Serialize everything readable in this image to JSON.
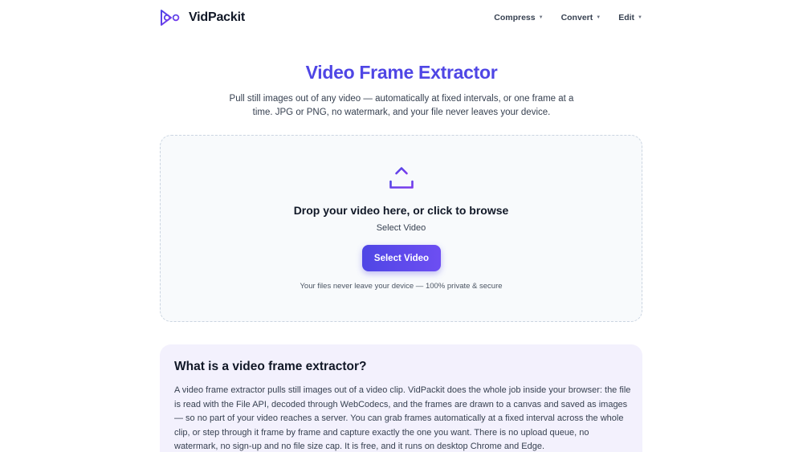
{
  "header": {
    "brand": "VidPackit",
    "nav": [
      {
        "label": "Compress"
      },
      {
        "label": "Convert"
      },
      {
        "label": "Edit"
      }
    ]
  },
  "hero": {
    "title": "Video Frame Extractor",
    "subtitle": "Pull still images out of any video — automatically at fixed intervals, or one frame at a time. JPG or PNG, no watermark, and your file never leaves your device."
  },
  "upload": {
    "title": "Drop your video here, or click to browse",
    "subtitle": "Select Video",
    "button_label": "Select Video",
    "privacy_note": "Your files never leave your device — 100% private & secure"
  },
  "info": {
    "title": "What is a video frame extractor?",
    "body": "A video frame extractor pulls still images out of a video clip. VidPackit does the whole job inside your browser: the file is read with the File API, decoded through WebCodecs, and the frames are drawn to a canvas and saved as images — so no part of your video reaches a server. You can grab frames automatically at a fixed interval across the whole clip, or step through it frame by frame and capture exactly the one you want. There is no upload queue, no watermark, no sign-up and no file size cap. It is free, and it runs on desktop Chrome and Edge."
  },
  "colors": {
    "accent": "#4f46e5",
    "accent_secondary": "#7c3aed",
    "info_background": "#f3f1fd"
  },
  "icons": {
    "logo": "vidpackit-logo-icon",
    "upload": "upload-icon",
    "caret": "chevron-down-icon"
  }
}
